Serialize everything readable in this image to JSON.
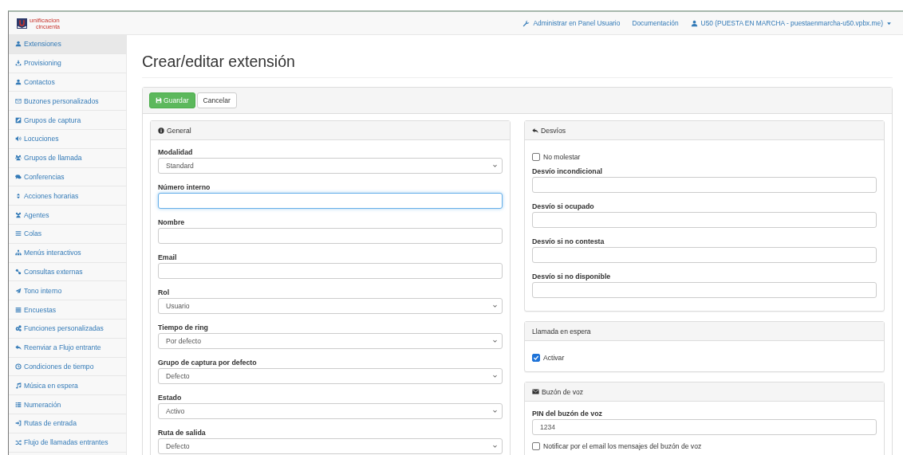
{
  "logo": {
    "name": "unificacion",
    "tagline": "cincuenta"
  },
  "navbar": {
    "links": [
      {
        "label": "Administrar en Panel Usuario",
        "kind": "wrench"
      },
      {
        "label": "Documentación",
        "kind": "plain"
      },
      {
        "label": "U50 (PUESTA EN MARCHA - puestaenmarcha-u50.vpbx.me)",
        "kind": "user"
      }
    ]
  },
  "sidebar": {
    "items": [
      {
        "label": "Extensiones",
        "selected": true
      },
      {
        "label": "Provisioning",
        "selected": false
      },
      {
        "label": "Contactos",
        "selected": false
      },
      {
        "label": "Buzones personalizados",
        "selected": false
      },
      {
        "label": "Grupos de captura",
        "selected": false
      },
      {
        "label": "Locuciones",
        "selected": false
      },
      {
        "label": "Grupos de llamada",
        "selected": false
      },
      {
        "label": "Conferencias",
        "selected": false
      },
      {
        "label": "Acciones horarias",
        "selected": false
      },
      {
        "label": "Agentes",
        "selected": false
      },
      {
        "label": "Colas",
        "selected": false
      },
      {
        "label": "Menús interactivos",
        "selected": false
      },
      {
        "label": "Consultas externas",
        "selected": false
      },
      {
        "label": "Tono interno",
        "selected": false
      },
      {
        "label": "Encuestas",
        "selected": false
      },
      {
        "label": "Funciones personalizadas",
        "selected": false
      },
      {
        "label": "Reenviar a Flujo entrante",
        "selected": false
      },
      {
        "label": "Condiciones de tiempo",
        "selected": false
      },
      {
        "label": "Música en espera",
        "selected": false
      },
      {
        "label": "Numeración",
        "selected": false
      },
      {
        "label": "Rutas de entrada",
        "selected": false
      },
      {
        "label": "Flujo de llamadas entrantes",
        "selected": false
      }
    ]
  },
  "page": {
    "title": "Crear/editar extensión"
  },
  "toolbar": {
    "buttons": [
      {
        "label": "Guardar",
        "kind": "primary"
      },
      {
        "label": "Cancelar",
        "kind": "default"
      }
    ]
  },
  "left_panels": [
    {
      "title": "General",
      "fields": [
        {
          "kind": "select",
          "label": "Modalidad",
          "value": "Standard",
          "focused": false
        },
        {
          "kind": "input",
          "label": "Número interno",
          "focused": true
        },
        {
          "kind": "input",
          "label": "Nombre",
          "focused": false
        },
        {
          "kind": "input",
          "label": "Email",
          "focused": false
        },
        {
          "kind": "select",
          "label": "Rol",
          "value": "Usuario",
          "focused": false
        },
        {
          "kind": "select",
          "label": "Tiempo de ring",
          "value": "Por defecto",
          "focused": false
        },
        {
          "kind": "select",
          "label": "Grupo de captura por defecto",
          "value": "Defecto",
          "focused": false
        },
        {
          "kind": "select",
          "label": "Estado",
          "value": "Activo",
          "focused": false
        },
        {
          "kind": "select",
          "label": "Ruta de salida",
          "value": "Defecto",
          "focused": false
        }
      ]
    }
  ],
  "right_panels": [
    {
      "title": "Desvíos",
      "fields": [
        {
          "kind": "checkbox",
          "label": "No molestar",
          "checked": false
        },
        {
          "kind": "input",
          "label": "Desvío incondicional",
          "focused": false
        },
        {
          "kind": "input",
          "label": "Desvío si ocupado",
          "focused": false
        },
        {
          "kind": "input",
          "label": "Desvío si no contesta",
          "focused": false
        },
        {
          "kind": "input",
          "label": "Desvío si no disponible",
          "focused": false
        }
      ]
    },
    {
      "title": "Llamada en espera",
      "fields": [
        {
          "kind": "checkbox",
          "label": "Activar",
          "checked": true
        }
      ]
    },
    {
      "title": "Buzón de voz",
      "fields": [
        {
          "kind": "input",
          "label": "PIN del buzón de voz",
          "value": "1234",
          "focused": false
        },
        {
          "kind": "checkbox",
          "label": "Notificar por el email los mensajes del buzón de voz",
          "checked": false
        }
      ]
    }
  ]
}
